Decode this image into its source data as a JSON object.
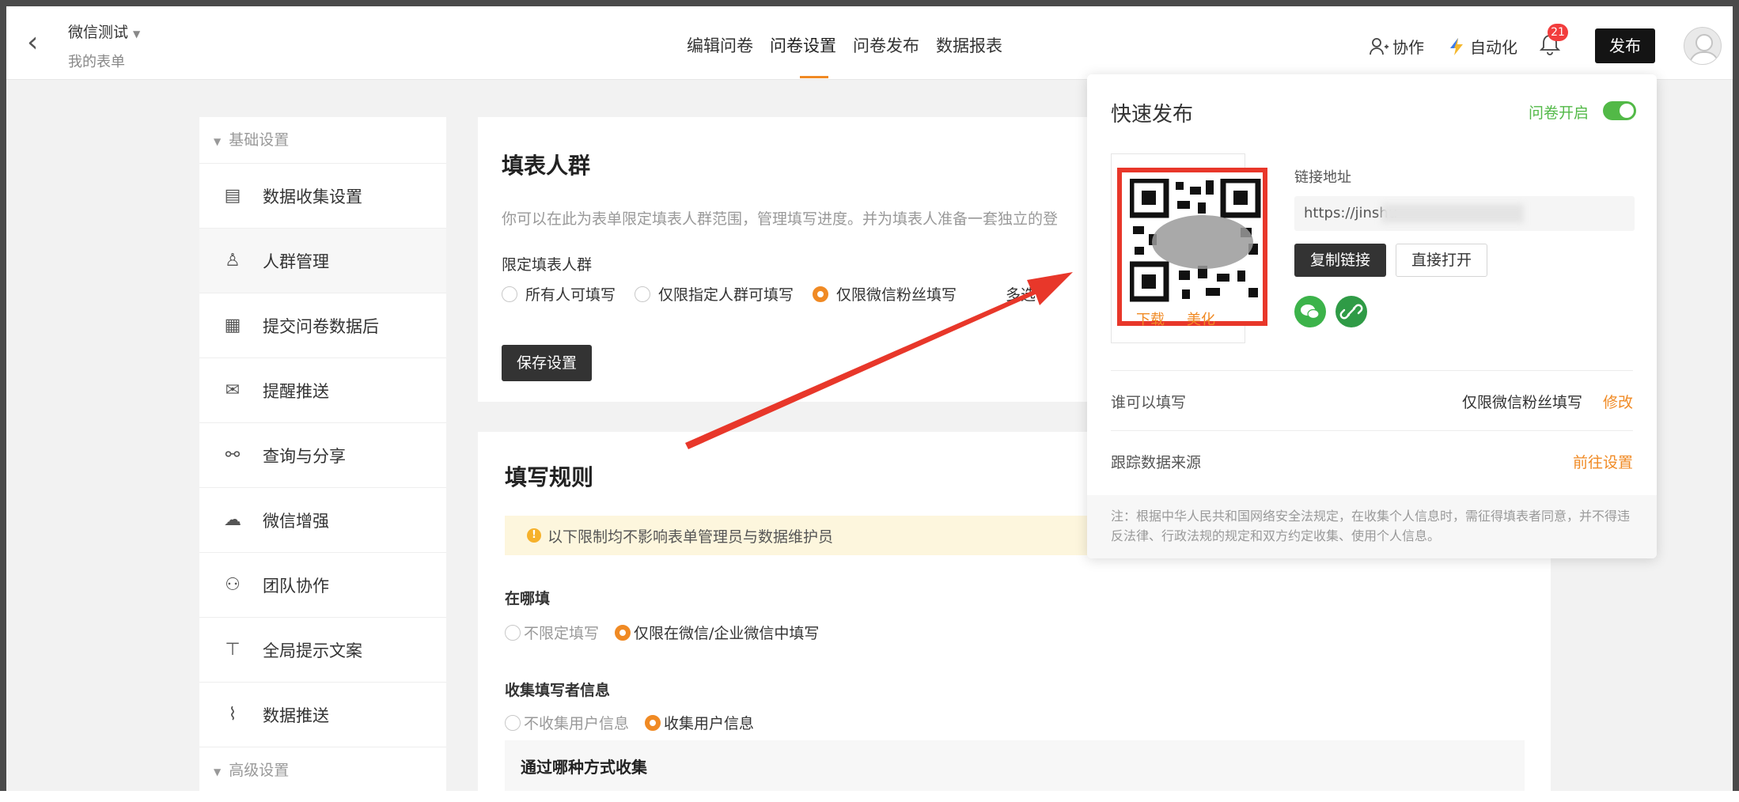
{
  "header": {
    "back_icon": "chevron-left-icon",
    "form_name": "微信测试",
    "my_forms": "我的表单",
    "nav": [
      "编辑问卷",
      "问卷设置",
      "问卷发布",
      "数据报表"
    ],
    "active_nav": "问卷设置",
    "collab_label": "协作",
    "automation_label": "自动化",
    "notification_count": "21",
    "publish_label": "发布"
  },
  "sidebar": {
    "basic_group": "基础设置",
    "items": [
      {
        "label": "数据收集设置",
        "icon": "document-icon"
      },
      {
        "label": "人群管理",
        "icon": "user-group-icon"
      },
      {
        "label": "提交问卷数据后",
        "icon": "submit-doc-icon"
      },
      {
        "label": "提醒推送",
        "icon": "mail-icon"
      },
      {
        "label": "查询与分享",
        "icon": "share-icon"
      },
      {
        "label": "微信增强",
        "icon": "wechat-icon"
      },
      {
        "label": "团队协作",
        "icon": "team-icon"
      },
      {
        "label": "全局提示文案",
        "icon": "text-icon"
      },
      {
        "label": "数据推送",
        "icon": "chart-icon"
      }
    ],
    "advanced_group": "高级设置"
  },
  "crowd_card": {
    "title": "填表人群",
    "description": "你可以在此为表单限定填表人群范围，管理填写进度。并为填表人准备一套独立的登",
    "restrict_label": "限定填表人群",
    "options": [
      "所有人可填写",
      "仅限指定人群可填写",
      "仅限微信粉丝填写",
      "多选"
    ],
    "selected": "仅限微信粉丝填写",
    "save_label": "保存设置"
  },
  "rules_card": {
    "title": "填写规则",
    "notice": "以下限制均不影响表单管理员与数据维护员",
    "where_label": "在哪填",
    "where_options": [
      "不限定填写",
      "仅限在微信/企业微信中填写"
    ],
    "collect_label": "收集填写者信息",
    "collect_options": [
      "不收集用户信息",
      "收集用户信息"
    ],
    "method_label": "通过哪种方式收集"
  },
  "quick_publish": {
    "title": "快速发布",
    "open_label": "问卷开启",
    "link_label": "链接地址",
    "link_value": "https://jinshu",
    "copy_label": "复制链接",
    "open_direct_label": "直接打开",
    "qr_download": "下载",
    "qr_beautify": "美化",
    "who_can_fill_label": "谁可以填写",
    "who_can_fill_value": "仅限微信粉丝填写",
    "modify_label": "修改",
    "track_label": "跟踪数据来源",
    "track_link": "前往设置",
    "note": "注：根据中华人民共和国网络安全法规定，在收集个人信息时，需征得填表者同意，并不得违反法律、行政法规的规定和双方约定收集、使用个人信息。"
  },
  "colors": {
    "accent": "#f08a24",
    "success": "#52b947",
    "annotation_arrow": "#e8372a",
    "dark_button": "#333333"
  }
}
